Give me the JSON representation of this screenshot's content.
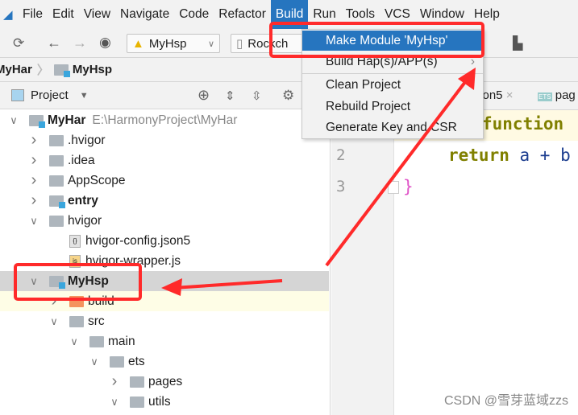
{
  "menubar": {
    "items": [
      "File",
      "Edit",
      "View",
      "Navigate",
      "Code",
      "Refactor",
      "Build",
      "Run",
      "Tools",
      "VCS",
      "Window",
      "Help"
    ],
    "active": "Build"
  },
  "toolbar": {
    "module_select": "MyHsp",
    "device_select": "Rockch"
  },
  "breadcrumb": [
    "MyHar",
    "MyHsp"
  ],
  "project_panel": {
    "title": "Project"
  },
  "tree": [
    {
      "label": "MyHar",
      "path": "E:\\HarmonyProject\\MyHar",
      "depth": 0,
      "expanded": true,
      "bold": true,
      "icon": "module-folder"
    },
    {
      "label": ".hvigor",
      "depth": 1,
      "expanded": false,
      "icon": "folder"
    },
    {
      "label": ".idea",
      "depth": 1,
      "expanded": false,
      "icon": "folder"
    },
    {
      "label": "AppScope",
      "depth": 1,
      "expanded": false,
      "icon": "folder"
    },
    {
      "label": "entry",
      "depth": 1,
      "expanded": false,
      "bold": true,
      "icon": "module-folder"
    },
    {
      "label": "hvigor",
      "depth": 1,
      "expanded": true,
      "icon": "folder"
    },
    {
      "label": "hvigor-config.json5",
      "depth": 2,
      "icon": "json-file"
    },
    {
      "label": "hvigor-wrapper.js",
      "depth": 2,
      "icon": "js-file"
    },
    {
      "label": "MyHsp",
      "depth": 1,
      "expanded": true,
      "bold": true,
      "icon": "module-folder",
      "selected": true
    },
    {
      "label": "build",
      "depth": 2,
      "expanded": false,
      "icon": "build-folder"
    },
    {
      "label": "src",
      "depth": 2,
      "expanded": true,
      "icon": "folder"
    },
    {
      "label": "main",
      "depth": 3,
      "expanded": true,
      "icon": "folder"
    },
    {
      "label": "ets",
      "depth": 4,
      "expanded": true,
      "icon": "folder"
    },
    {
      "label": "pages",
      "depth": 5,
      "expanded": false,
      "icon": "folder"
    },
    {
      "label": "utils",
      "depth": 5,
      "expanded": true,
      "icon": "folder"
    }
  ],
  "editor": {
    "tabs": [
      "son5",
      "pag"
    ],
    "lines": [
      {
        "n": "1",
        "code": "function"
      },
      {
        "n": "2",
        "kw": "return",
        "rest": " a + b"
      },
      {
        "n": "3",
        "code": "}"
      }
    ]
  },
  "build_menu": {
    "items": [
      "Make Module 'MyHsp'",
      "Build Hap(s)/APP(s)",
      "Clean Project",
      "Rebuild Project",
      "Generate Key and CSR"
    ],
    "highlighted": "Make Module 'MyHsp'"
  },
  "annotation_color": "#ff2a2a",
  "watermark": "CSDN @雪芽蓝域zzs"
}
